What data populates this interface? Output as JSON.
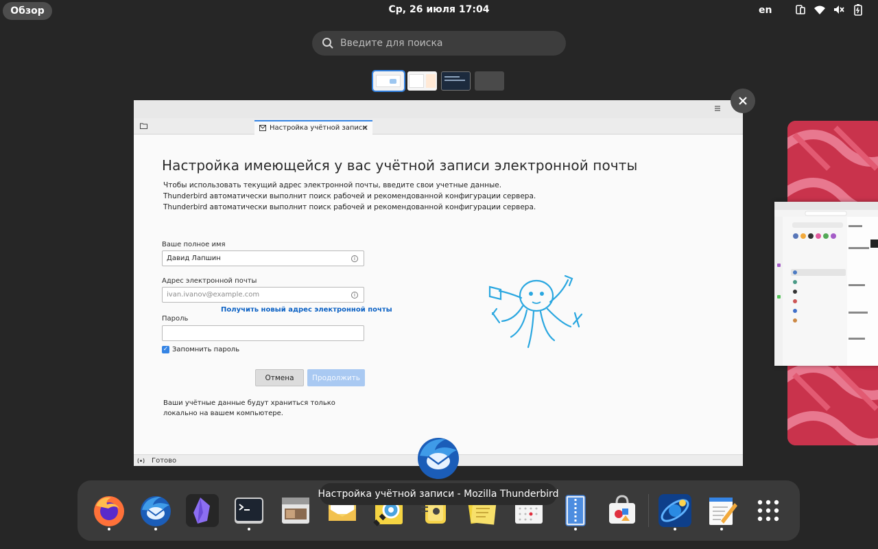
{
  "topbar": {
    "overview_label": "Обзор",
    "clock": "Ср, 26 июля  17:04",
    "lang": "en",
    "icons": [
      "phone-icon",
      "wifi-icon",
      "volume-muted-icon",
      "battery-icon"
    ]
  },
  "search": {
    "placeholder": "Введите для поиска"
  },
  "window": {
    "tab_label": "Настройка учётной записи",
    "heading": "Настройка имеющейся у вас учётной записи электронной почты",
    "desc_lines": [
      "Чтобы использовать текущий адрес электронной почты, введите свои учетные данные.",
      "Thunderbird автоматически выполнит поиск рабочей и рекомендованной конфигурации сервера.",
      "Thunderbird автоматически выполнит поиск рабочей и рекомендованной конфигурации сервера."
    ],
    "name_label": "Ваше полное имя",
    "name_value": "Давид Лапшин",
    "email_label": "Адрес электронной почты",
    "email_placeholder": "ivan.ivanov@example.com",
    "get_new_address": "Получить новый адрес электронной почты",
    "password_label": "Пароль",
    "password_value": "",
    "remember_password": "Запомнить пароль",
    "remember_checked": true,
    "cancel_label": "Отмена",
    "continue_label": "Продолжить",
    "note": "Ваши учётные данные будут храниться только локально на вашем компьютере.",
    "status": "Готово"
  },
  "side_preview": {
    "url": "https://app.element.io/#/",
    "space_name": "Gradience Space",
    "rooms": [
      "Water Cooler",
      "Gradience",
      "Bloxinator",
      "Presets",
      "Plugins",
      "Offs"
    ]
  },
  "tooltip": "Настройка учётной записи - Mozilla Thunderbird",
  "dock": {
    "apps": [
      {
        "name": "firefox-icon",
        "running": true
      },
      {
        "name": "thunderbird-icon",
        "running": true
      },
      {
        "name": "obsidian-icon",
        "running": false
      },
      {
        "name": "terminal-icon",
        "running": true
      },
      {
        "name": "file-manager-icon",
        "running": false
      },
      {
        "name": "mail-icon",
        "running": false
      },
      {
        "name": "image-viewer-icon",
        "running": false
      },
      {
        "name": "audio-player-icon",
        "running": false
      },
      {
        "name": "sticky-notes-icon",
        "running": false
      },
      {
        "name": "calendar-icon",
        "running": false
      },
      {
        "name": "archive-manager-icon",
        "running": true
      },
      {
        "name": "software-store-icon",
        "running": false
      },
      {
        "name": "kstars-icon",
        "running": true
      },
      {
        "name": "text-editor-icon",
        "running": true
      },
      {
        "name": "app-grid-icon",
        "running": false
      }
    ]
  },
  "colors": {
    "accent": "#3584e4",
    "link": "#0b61c4",
    "wallpaper": "#c9334c"
  }
}
